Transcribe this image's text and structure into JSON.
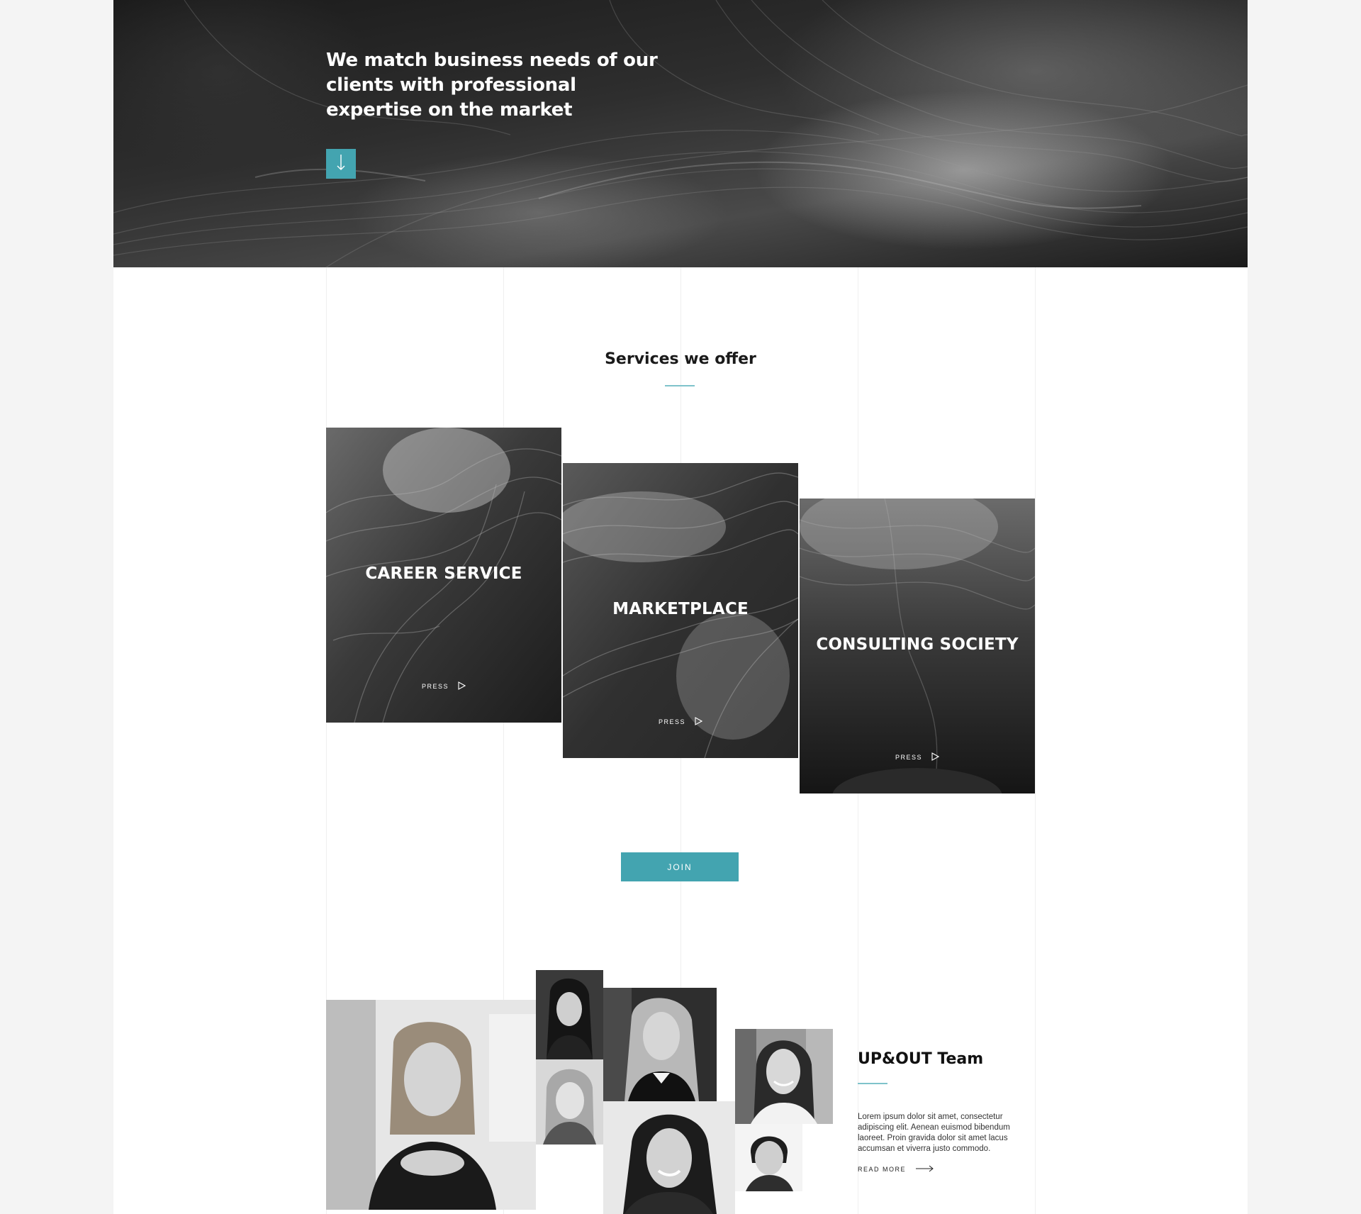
{
  "hero": {
    "title": "We match business needs of our clients with professional expertise on the market",
    "arrow_icon": "arrow-down-icon"
  },
  "services": {
    "title": "Services we offer",
    "cards": [
      {
        "title": "CAREER SERVICE",
        "action": "PRESS",
        "icon": "play-outline-icon"
      },
      {
        "title": "MARKETPLACE",
        "action": "PRESS",
        "icon": "play-outline-icon"
      },
      {
        "title": "CONSULTING SOCIETY",
        "action": "PRESS",
        "icon": "play-outline-icon"
      }
    ],
    "join_label": "JOIN"
  },
  "team": {
    "title": "UP&OUT Team",
    "description": "Lorem ipsum dolor sit amet, consectetur adipiscing elit. Aenean euismod bibendum laoreet. Proin gravida dolor sit amet lacus accumsan et viverra justo commodo.",
    "read_more": "READ MORE",
    "read_more_icon": "arrow-right-icon"
  },
  "colors": {
    "accent": "#43a4b0",
    "accent_light": "#7fc3cb",
    "background": "#f4f4f4",
    "page": "#ffffff"
  }
}
